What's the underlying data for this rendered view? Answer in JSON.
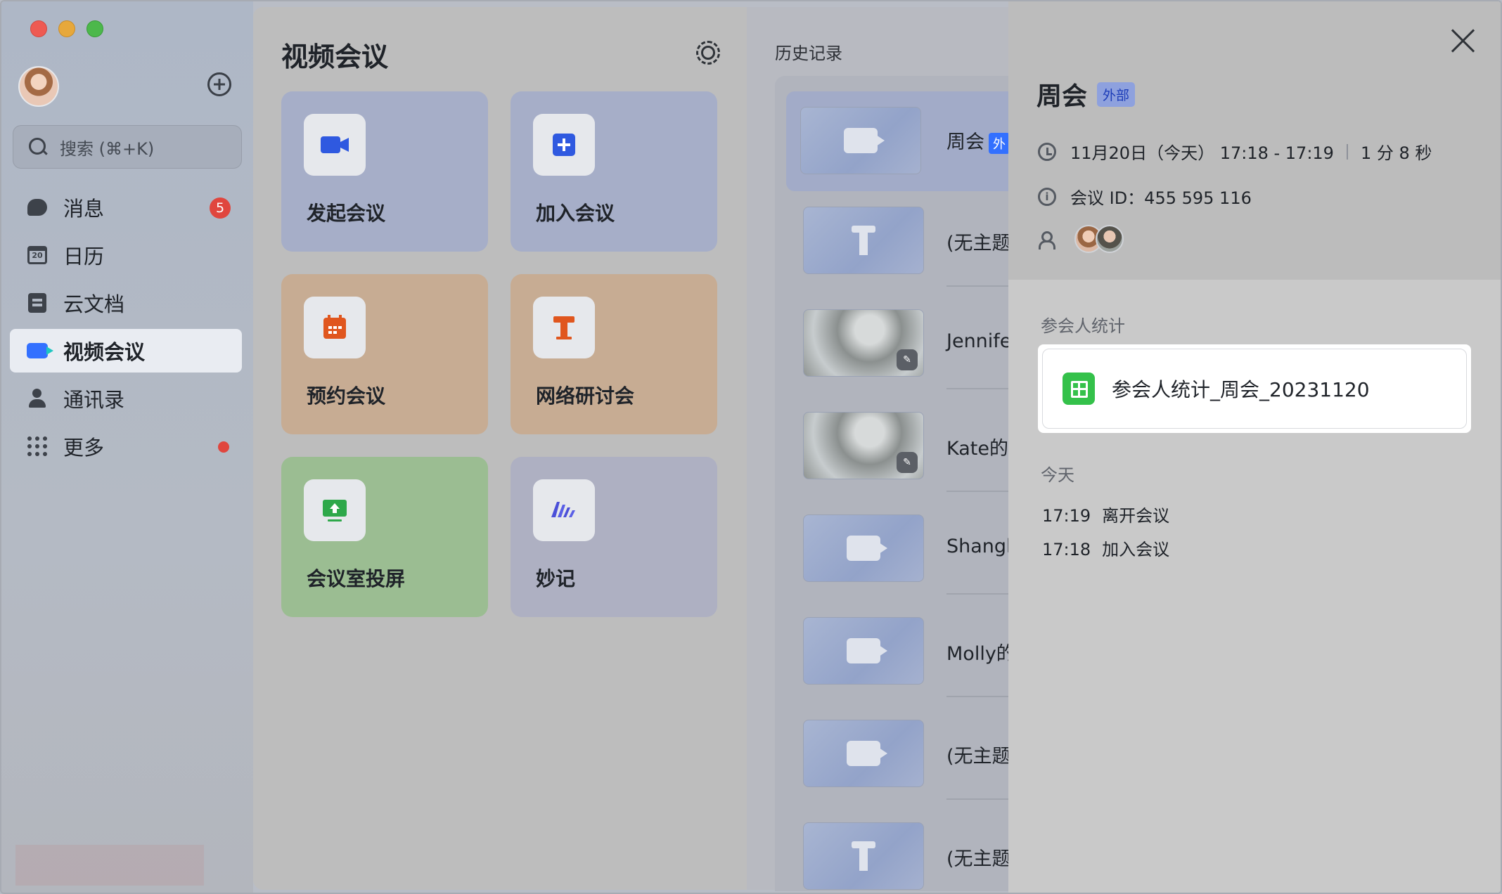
{
  "sidebar": {
    "search_placeholder": "搜索 (⌘+K)",
    "items": [
      {
        "label": "消息",
        "badge": "5",
        "icon": "message-icon"
      },
      {
        "label": "日历",
        "icon": "calendar-icon",
        "calendar_day": "20"
      },
      {
        "label": "云文档",
        "icon": "docs-icon"
      },
      {
        "label": "视频会议",
        "icon": "video-icon",
        "active": true
      },
      {
        "label": "通讯录",
        "icon": "contacts-icon"
      },
      {
        "label": "更多",
        "icon": "more-grid-icon",
        "dot": true
      }
    ]
  },
  "main": {
    "title": "视频会议",
    "cards": [
      {
        "label": "发起会议",
        "icon": "video-camera-icon",
        "color": "#a6aec8"
      },
      {
        "label": "加入会议",
        "icon": "plus-square-icon",
        "color": "#a6aec8"
      },
      {
        "label": "预约会议",
        "icon": "calendar-grid-icon",
        "color": "#c7ac93"
      },
      {
        "label": "网络研讨会",
        "icon": "podium-icon",
        "color": "#c7ac93"
      },
      {
        "label": "会议室投屏",
        "icon": "screen-share-icon",
        "color": "#9bbd92"
      },
      {
        "label": "妙记",
        "icon": "minutes-logo-icon",
        "color": "#aeb0c2"
      }
    ]
  },
  "history": {
    "title": "历史记录",
    "items": [
      {
        "name": "周会",
        "tag": "外",
        "thumb": "camera"
      },
      {
        "name": "(无主题",
        "thumb": "podium"
      },
      {
        "name": "Jennife",
        "thumb": "blur"
      },
      {
        "name": "Kate的",
        "thumb": "blur"
      },
      {
        "name": "Shangh",
        "thumb": "camera"
      },
      {
        "name": "Molly的",
        "thumb": "camera"
      },
      {
        "name": "(无主题",
        "thumb": "camera"
      },
      {
        "name": "(无主题",
        "thumb": "podium"
      }
    ]
  },
  "detail": {
    "title": "周会",
    "tag": "外部",
    "time": "11月20日（今天） 17:18 - 17:19",
    "duration": "1 分 8 秒",
    "meeting_id": "会议 ID：455 595 116",
    "stats_label": "参会人统计",
    "stats_file": "参会人统计_周会_20231120",
    "today_label": "今天",
    "logs": [
      {
        "time": "17:19",
        "event": "离开会议"
      },
      {
        "time": "17:18",
        "event": "加入会议"
      }
    ]
  },
  "colors": {
    "accent": "#3370ff",
    "badge": "#e0463e",
    "sheet": "#34c14a"
  }
}
